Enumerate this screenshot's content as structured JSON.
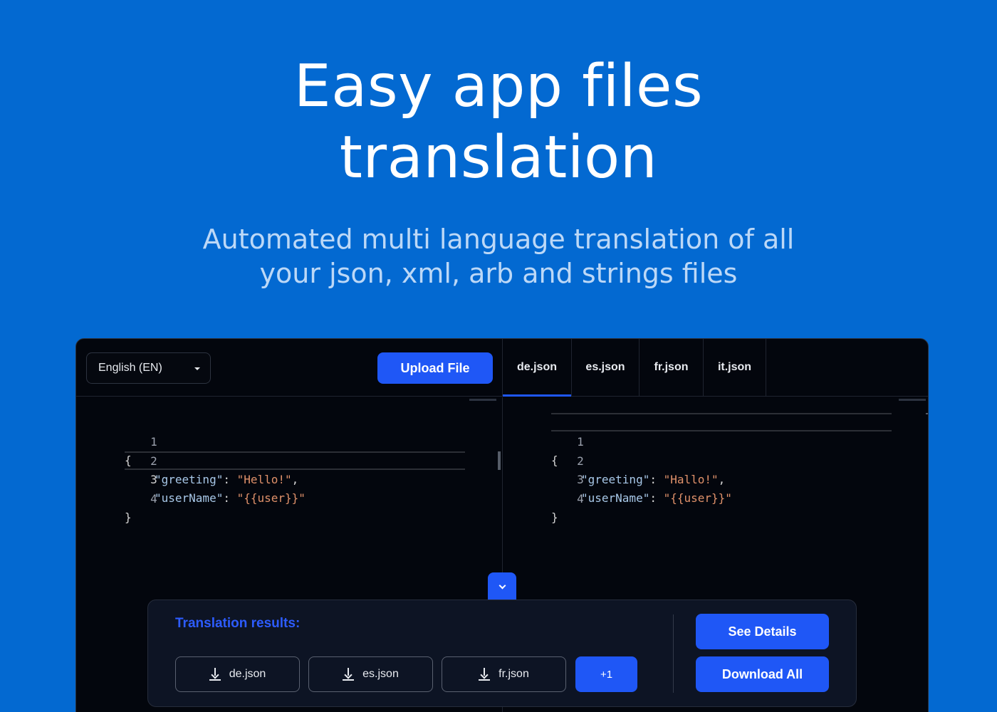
{
  "hero": {
    "title_line1": "Easy app files",
    "title_line2": "translation",
    "subtitle_line1": "Automated multi language translation of all",
    "subtitle_line2": "your json, xml, arb and strings files"
  },
  "toolbar": {
    "language": "English (EN)",
    "upload_label": "Upload File",
    "tabs": [
      {
        "label": "de.json",
        "active": true
      },
      {
        "label": "es.json",
        "active": false
      },
      {
        "label": "fr.json",
        "active": false
      },
      {
        "label": "it.json",
        "active": false
      }
    ]
  },
  "source_editor": {
    "lines": [
      {
        "n": "1",
        "open": "{"
      },
      {
        "n": "2",
        "key": "\"greeting\"",
        "sep": ": ",
        "value": "\"Hello!\"",
        "end": ","
      },
      {
        "n": "3",
        "key": "\"userName\"",
        "sep": ": ",
        "value": "\"{{user}}\"",
        "end": ""
      },
      {
        "n": "4",
        "open": "}"
      }
    ]
  },
  "target_editor": {
    "lines": [
      {
        "n": "1",
        "open": "{"
      },
      {
        "n": "2",
        "key": "\"greeting\"",
        "sep": ": ",
        "value": "\"Hallo!\"",
        "end": ","
      },
      {
        "n": "3",
        "key": "\"userName\"",
        "sep": ": ",
        "value": "\"{{user}}\"",
        "end": ""
      },
      {
        "n": "4",
        "open": "}"
      }
    ]
  },
  "results": {
    "title": "Translation results:",
    "files": [
      "de.json",
      "es.json",
      "fr.json"
    ],
    "more_label": "+1",
    "see_details_label": "See Details",
    "download_all_label": "Download All"
  },
  "colors": {
    "background": "#0369d1",
    "accent": "#1f57f6",
    "panel": "#03060d",
    "string": "#e0916a",
    "key": "#a8c8e8"
  }
}
